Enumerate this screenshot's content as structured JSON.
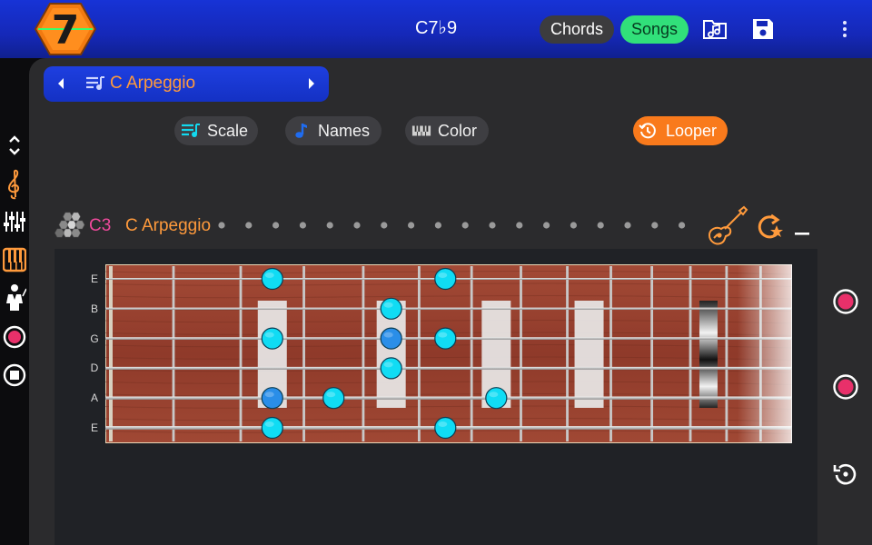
{
  "header": {
    "title": "C7♭9",
    "chords_label": "Chords",
    "songs_label": "Songs",
    "logo_text": "7"
  },
  "selector": {
    "label": "C Arpeggio"
  },
  "chips": {
    "scale": "Scale",
    "names": "Names",
    "color": "Color",
    "looper": "Looper"
  },
  "section": {
    "note": "C3",
    "scale_name": "C Arpeggio"
  },
  "strings": [
    "E",
    "B",
    "G",
    "D",
    "A",
    "E"
  ],
  "colors": {
    "topbar": "#1528b8",
    "accent_orange": "#ff9a3c",
    "looper": "#f97a1c",
    "songs": "#31e07a",
    "note_pink": "#f04a9c",
    "marker_cyan": "#10dcf4",
    "marker_blue": "#2a8ee8",
    "record_pink": "#e8306a"
  },
  "icons": {
    "left_toolbar": [
      "up-down-arrows-icon",
      "treble-clef-icon",
      "mixer-sliders-icon",
      "piano-keys-icon",
      "conductor-icon",
      "record-icon",
      "stop-icon"
    ],
    "right_toolbar": [
      "record-icon",
      "record-icon",
      "replay-icon"
    ]
  },
  "fretboard": {
    "frets": 16,
    "inlay_frets": [
      3,
      5,
      7,
      9,
      15
    ],
    "double_inlay_fret": 12,
    "notes": [
      {
        "string": 0,
        "fret": 3,
        "root": false
      },
      {
        "string": 0,
        "fret": 6,
        "root": false
      },
      {
        "string": 1,
        "fret": 5,
        "root": false
      },
      {
        "string": 2,
        "fret": 3,
        "root": false
      },
      {
        "string": 2,
        "fret": 5,
        "root": true
      },
      {
        "string": 2,
        "fret": 6,
        "root": false
      },
      {
        "string": 3,
        "fret": 5,
        "root": false
      },
      {
        "string": 4,
        "fret": 3,
        "root": true
      },
      {
        "string": 4,
        "fret": 4,
        "root": false
      },
      {
        "string": 4,
        "fret": 7,
        "root": false
      },
      {
        "string": 5,
        "fret": 3,
        "root": false
      },
      {
        "string": 5,
        "fret": 6,
        "root": false
      }
    ]
  }
}
